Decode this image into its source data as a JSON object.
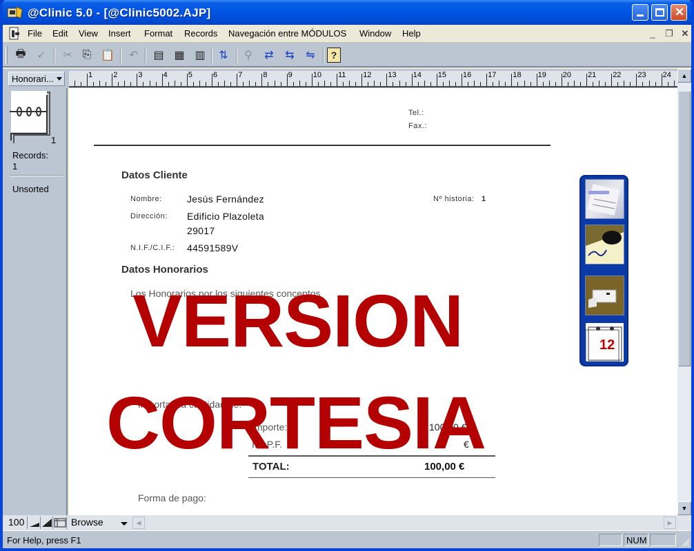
{
  "window": {
    "title": "@Clinic 5.0 - [@Clinic5002.AJP]",
    "minimize_glyph": "_",
    "maximize_glyph": "□",
    "close_glyph": "✕"
  },
  "menu": {
    "items": [
      "File",
      "Edit",
      "View",
      "Insert",
      "Format",
      "Records",
      "Navegación entre MÓDULOS",
      "Window",
      "Help"
    ],
    "mdi_minimize": "_",
    "mdi_restore": "❐",
    "mdi_close": "✕"
  },
  "toolbar": {
    "buttons": [
      {
        "icon": "print-icon",
        "glyph": "🖶"
      },
      {
        "icon": "spellcheck-icon",
        "glyph": "✓"
      },
      {
        "icon": "cut-icon",
        "glyph": "✂"
      },
      {
        "icon": "copy-icon",
        "glyph": "⎘"
      },
      {
        "icon": "paste-icon",
        "glyph": "📋"
      },
      {
        "icon": "undo-icon",
        "glyph": "↶"
      },
      {
        "icon": "new-record-icon",
        "glyph": "▤"
      },
      {
        "icon": "duplicate-record-icon",
        "glyph": "▦"
      },
      {
        "icon": "delete-record-icon",
        "glyph": "▥"
      },
      {
        "icon": "sort-icon",
        "glyph": "⇅"
      },
      {
        "icon": "find-icon",
        "glyph": "⚲"
      },
      {
        "icon": "import-icon",
        "glyph": "⇄"
      },
      {
        "icon": "export-icon",
        "glyph": "⇆"
      },
      {
        "icon": "replace-icon",
        "glyph": "⇋"
      },
      {
        "icon": "help-icon",
        "glyph": "?"
      }
    ]
  },
  "layout": {
    "selected": "Honorari..."
  },
  "ruler": {
    "labels": [
      "1",
      "2",
      "3",
      "4",
      "5",
      "6",
      "7",
      "8",
      "9",
      "10",
      "11",
      "12",
      "13",
      "14",
      "15",
      "16",
      "17",
      "18",
      "19",
      "20",
      "21",
      "22",
      "23",
      "24"
    ]
  },
  "sidebar": {
    "book_page": "1",
    "records_label": "Records:",
    "records_count": "1",
    "sort_status": "Unsorted"
  },
  "document": {
    "tel_label": "Tel.:",
    "fax_label": "Fax.:",
    "section_client": "Datos Cliente",
    "nombre_label": "Nombre:",
    "nombre_value": "Jesús Fernández",
    "historia_label": "Nº historia:",
    "historia_value": "1",
    "direccion_label": "Dirección:",
    "direccion_line1": "Edificio Plazoleta",
    "direccion_line2": "29017",
    "nif_label": "N.I.F./C.I.F.:",
    "nif_value": "44591589V",
    "section_fees": "Datos Honorarios",
    "concepts_text": "Los Honorarios por los siguientes conceptos",
    "amount_text": "Importan la cantidad de:",
    "importe_label": "Importe:",
    "importe_value": "100,00 €",
    "irpf_label": "I.R.P.F.",
    "irpf_pct": "%",
    "irpf_value": "€",
    "total_label": "TOTAL:",
    "total_value": "100,00 €",
    "payment_label": "Forma de pago:",
    "watermark_line1": "VERSION",
    "watermark_line2": "CORTESIA"
  },
  "nav_panel": {
    "buttons": [
      "documents-module",
      "signature-module",
      "printer-module",
      "calendar-module"
    ],
    "calendar_day": "12"
  },
  "bottombar": {
    "zoom": "100",
    "mode": "Browse"
  },
  "status": {
    "help_text": "For Help, press F1",
    "num_indicator": "NUM"
  },
  "colors": {
    "watermark": "#b40000",
    "title_bar": "#0054e3",
    "nav_panel": "#0b3aa6"
  }
}
